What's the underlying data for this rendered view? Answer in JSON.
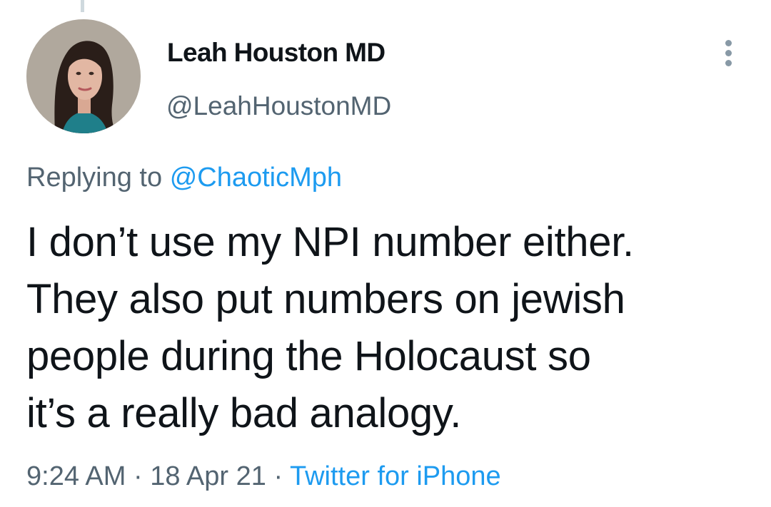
{
  "author": {
    "display_name": "Leah Houston MD",
    "handle": "@LeahHoustonMD"
  },
  "reply": {
    "prefix": "Replying to",
    "mention": "@ChaoticMph"
  },
  "tweet": {
    "text": "I don’t use my NPI number either.\nThey also put numbers on jewish\npeople during the Holocaust so\nit’s a really bad analogy."
  },
  "meta": {
    "time": "9:24 AM",
    "date": "18 Apr 21",
    "separator": "·",
    "source": "Twitter for iPhone"
  },
  "icons": {
    "more": "more-vertical-icon"
  },
  "colors": {
    "text": "#0f1419",
    "secondary": "#536471",
    "link": "#1d9bf0"
  }
}
